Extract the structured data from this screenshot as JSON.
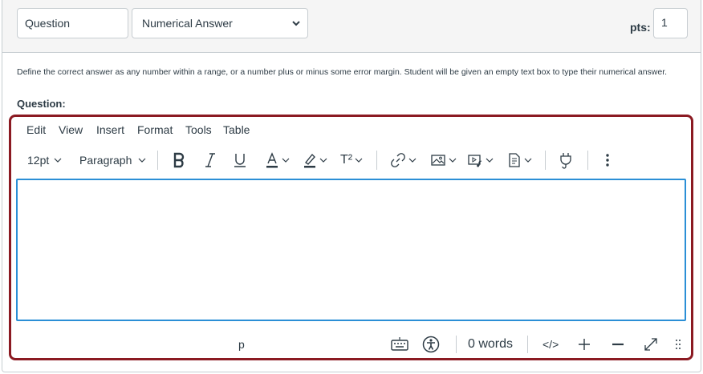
{
  "header": {
    "question_name": "Question",
    "question_type": "Numerical Answer",
    "pts_label": "pts:",
    "pts_value": "1"
  },
  "description": "Define the correct answer as any number within a range, or a number plus or minus some error margin. Student will be given an empty text box to type their numerical answer.",
  "question_label": "Question:",
  "editor": {
    "menu": [
      "Edit",
      "View",
      "Insert",
      "Format",
      "Tools",
      "Table"
    ],
    "toolbar": {
      "font_size": "12pt",
      "block_format": "Paragraph",
      "superscript_label": "T²"
    },
    "content": "",
    "status": {
      "path": "p",
      "word_count": "0 words",
      "html_toggle": "</>"
    }
  },
  "colors": {
    "editor_border": "#8b1a22",
    "content_focus": "#2b8fd6"
  }
}
